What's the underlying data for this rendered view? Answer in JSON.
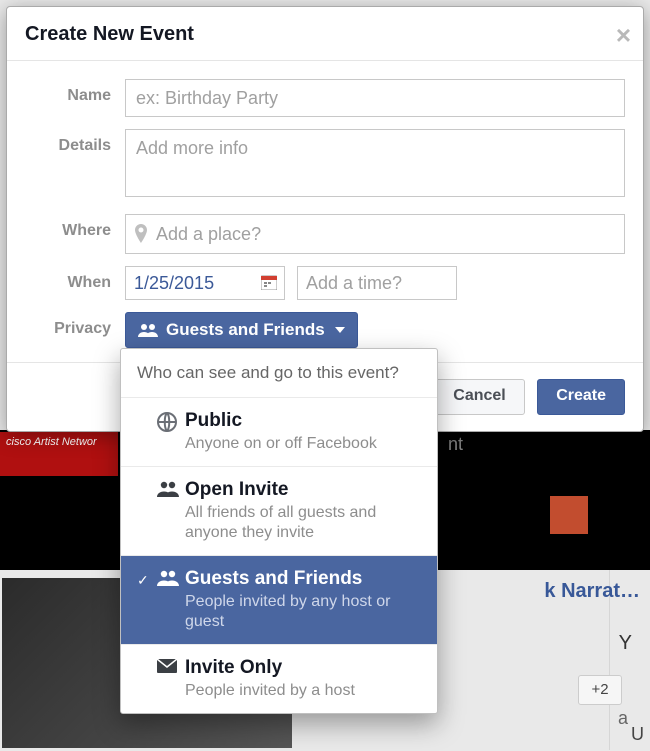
{
  "modal": {
    "title": "Create New Event",
    "labels": {
      "name": "Name",
      "details": "Details",
      "where": "Where",
      "when": "When",
      "privacy": "Privacy"
    },
    "placeholders": {
      "name": "ex: Birthday Party",
      "details": "Add more info",
      "where": "Add a place?",
      "time": "Add a time?"
    },
    "values": {
      "date": "1/25/2015",
      "privacy_selected": "Guests and Friends"
    },
    "buttons": {
      "cancel": "Cancel",
      "create": "Create"
    }
  },
  "privacy_dropdown": {
    "title": "Who can see and go to this event?",
    "options": [
      {
        "icon": "globe-icon",
        "title": "Public",
        "desc": "Anyone on or off Facebook",
        "selected": false
      },
      {
        "icon": "group-icon",
        "title": "Open Invite",
        "desc": "All friends of all guests and anyone they invite",
        "selected": false
      },
      {
        "icon": "group-icon",
        "title": "Guests and Friends",
        "desc": "People invited by any host or guest",
        "selected": true
      },
      {
        "icon": "envelope-icon",
        "title": "Invite Only",
        "desc": "People invited by a host",
        "selected": false
      }
    ]
  },
  "background": {
    "red_text": "cisco Artist Networ",
    "letter_nt": "nt",
    "link_text": "k Narrat…",
    "plus2": "+2",
    "letter_Y": "Y",
    "letter_a": "a",
    "letter_U": "U"
  }
}
